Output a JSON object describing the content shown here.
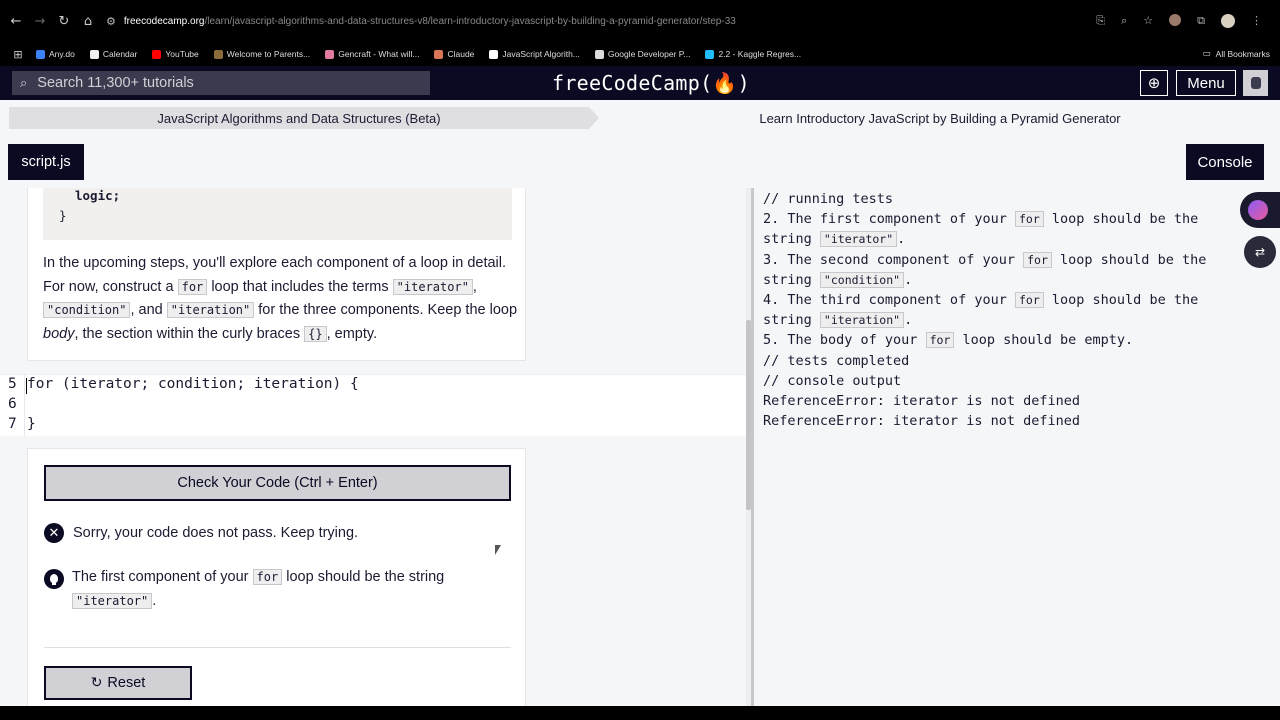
{
  "browser": {
    "url_domain": "freecodecamp.org",
    "url_path": "/learn/javascript-algorithms-and-data-structures-v8/learn-introductory-javascript-by-building-a-pyramid-generator/step-33",
    "bookmarks": [
      {
        "label": "Any.do",
        "color": "#3b82f6"
      },
      {
        "label": "Calendar",
        "color": "#f1f1f1"
      },
      {
        "label": "YouTube",
        "color": "#ff0000"
      },
      {
        "label": "Welcome to Parents...",
        "color": "#8a6d3b"
      },
      {
        "label": "Gencraft - What will...",
        "color": "#e07aa0"
      },
      {
        "label": "Claude",
        "color": "#d97757"
      },
      {
        "label": "JavaScript Algorith...",
        "color": "#ffffff"
      },
      {
        "label": "Google Developer P...",
        "color": "#dddddd"
      },
      {
        "label": "2.2 - Kaggle Regres...",
        "color": "#20beff"
      }
    ],
    "all_bookmarks": "All Bookmarks"
  },
  "header": {
    "search_placeholder": "Search 11,300+ tutorials",
    "logo": "freeCodeCamp(🔥)",
    "menu_label": "Menu"
  },
  "breadcrumb": {
    "left": "JavaScript Algorithms and Data Structures (Beta)",
    "right": "Learn Introductory JavaScript by Building a Pyramid Generator"
  },
  "tabs": {
    "file": "script.js",
    "console": "Console"
  },
  "description": {
    "snippet_line1": "logic;",
    "snippet_line2": "}",
    "p1": "In the upcoming steps, you'll explore each component of a loop in detail. For now, construct a",
    "code_for": "for",
    "p2": "loop that includes the terms",
    "code_iterator": "\"iterator\"",
    "p3": ",",
    "code_condition": "\"condition\"",
    "p4": ", and",
    "code_iteration": "\"iteration\"",
    "p5": "for the three components. Keep the loop",
    "em_body": "body",
    "p6": ", the section within the curly braces",
    "code_braces": "{}",
    "p7": ", empty."
  },
  "editor": {
    "lines": [
      {
        "num": "5",
        "code": "for (iterator; condition; iteration) {"
      },
      {
        "num": "6",
        "code": ""
      },
      {
        "num": "7",
        "code": "}"
      }
    ]
  },
  "results": {
    "check_button": "Check Your Code (Ctrl + Enter)",
    "fail_message": "Sorry, your code does not pass. Keep trying.",
    "hint_pre": "The first component of your",
    "hint_code_for": "for",
    "hint_mid": "loop should be the string",
    "hint_code_iterator": "\"iterator\"",
    "hint_post": ".",
    "reset_button": "Reset"
  },
  "console": {
    "running": "// running tests",
    "t2_pre": "2. The first component of your",
    "t2_code": "for",
    "t2_mid": "loop should be the string",
    "t2_str": "\"iterator\"",
    "t3_pre": "3. The second component of your",
    "t3_code": "for",
    "t3_mid": "loop should be the string",
    "t3_str": "\"condition\"",
    "t4_pre": "4. The third component of your",
    "t4_code": "for",
    "t4_mid": "loop should be the string",
    "t4_str": "\"iteration\"",
    "t5_pre": "5. The body of your",
    "t5_code": "for",
    "t5_post": "loop should be empty.",
    "completed": "// tests completed",
    "output_header": "// console output",
    "error1": "ReferenceError: iterator is not defined",
    "error2": "ReferenceError: iterator is not defined"
  },
  "colors": {
    "fcc_dark": "#0a0a23",
    "panel_bg": "#f5f6f7",
    "button_gray": "#d0d0d5"
  },
  "icons": [
    "back-icon",
    "forward-icon",
    "reload-icon",
    "home-icon",
    "search-icon",
    "globe-icon",
    "user-icon",
    "x-icon",
    "lightbulb-icon",
    "reset-icon"
  ]
}
